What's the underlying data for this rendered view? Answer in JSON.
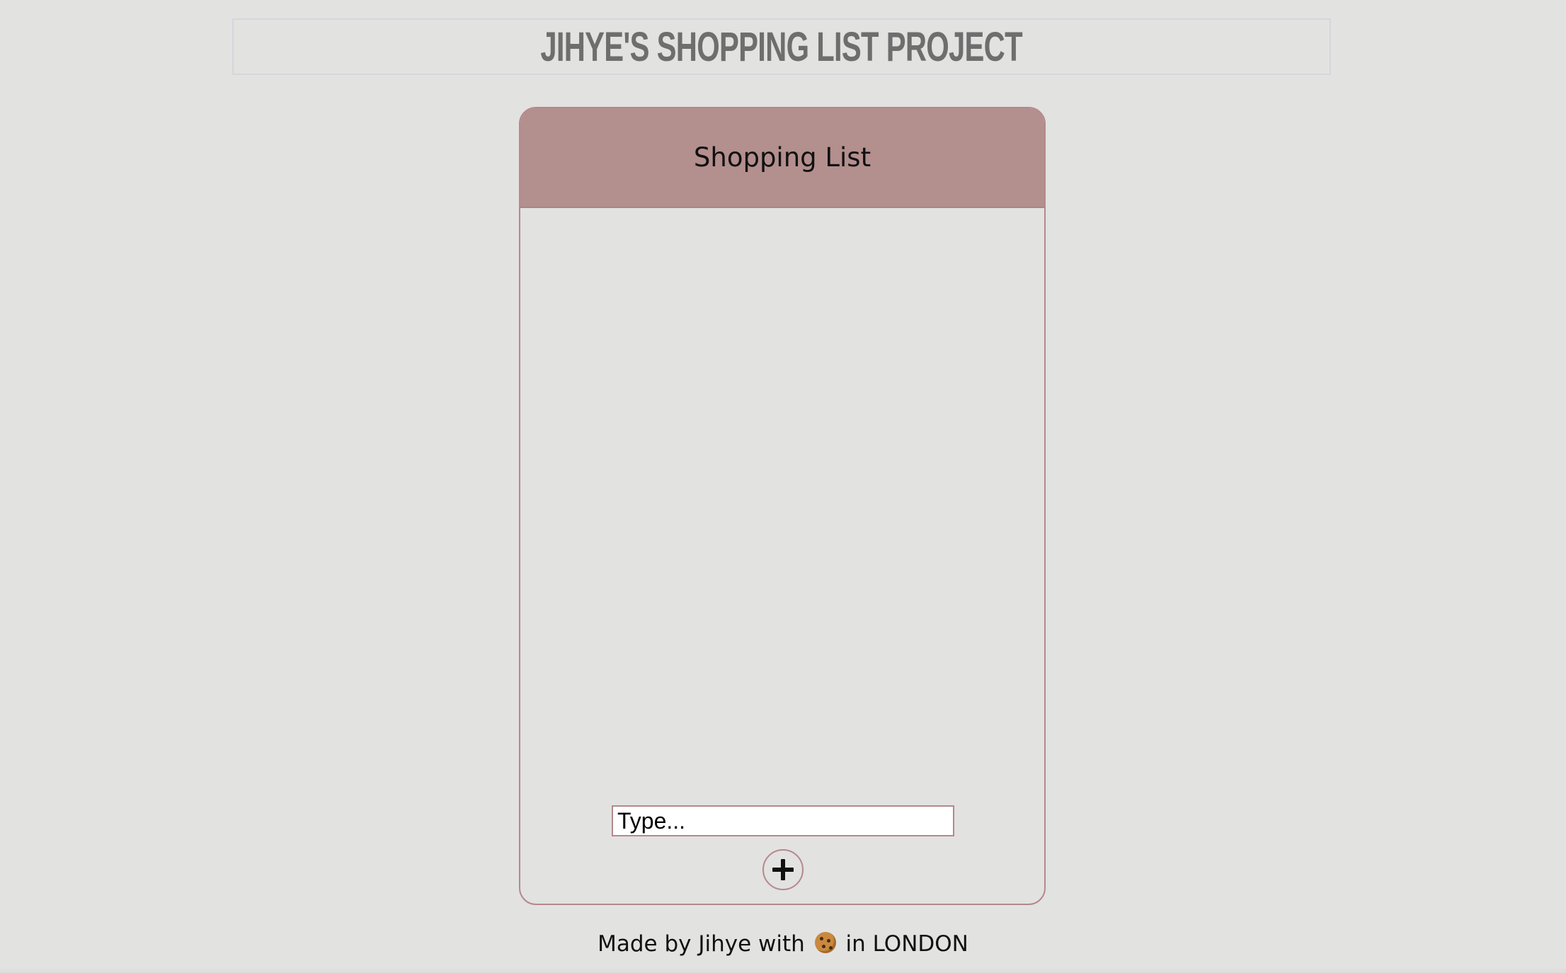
{
  "header": {
    "title": "JIHYE'S SHOPPING LIST PROJECT"
  },
  "card": {
    "title": "Shopping List",
    "items": []
  },
  "input": {
    "placeholder": "Type...",
    "value": ""
  },
  "add_button": {
    "icon": "plus-icon"
  },
  "footer": {
    "prefix": "Made by Jihye with",
    "icon": "cookie-icon",
    "suffix": "in LONDON"
  },
  "colors": {
    "background": "#e2e2e1",
    "accent": "#b38f8e",
    "border": "#b4898b",
    "title_text": "#6e6e6e"
  }
}
